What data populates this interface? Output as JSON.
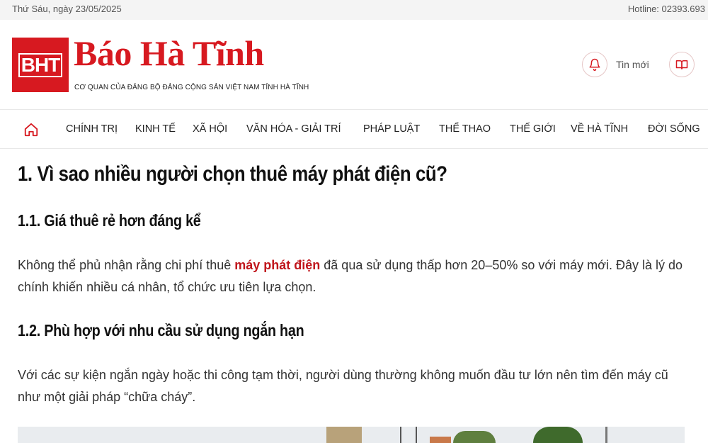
{
  "topbar": {
    "date": "Thứ Sáu, ngày 23/05/2025",
    "hotline": "Hotline: 02393.693"
  },
  "header": {
    "logo_mark": "BHT",
    "logo_title": "Báo Hà Tĩnh",
    "logo_subtitle": "CƠ QUAN CỦA ĐẢNG BỘ ĐẢNG CỘNG SẢN VIỆT NAM TỈNH HÀ TĨNH",
    "news_button_label": "Tin mới",
    "brand_color": "#d71920"
  },
  "nav": {
    "items": [
      "CHÍNH TRỊ",
      "KINH TẾ",
      "XÃ HỘI",
      "VĂN HÓA - GIẢI TRÍ",
      "PHÁP LUẬT",
      "THỂ THAO",
      "THẾ GIỚI",
      "VỀ HÀ TĨNH",
      "ĐỜI SỐNG"
    ]
  },
  "article": {
    "heading": "1. Vì sao nhiều người chọn thuê máy phát điện cũ?",
    "sections": [
      {
        "heading": "1.1. Giá thuê rẻ hơn đáng kể",
        "text_before_link": "Không thể phủ nhận rằng chi phí thuê ",
        "link": "máy phát điện",
        "text_after_link": " đã qua sử dụng thấp hơn 20–50% so với máy mới. Đây là lý do chính khiến nhiều cá nhân, tổ chức ưu tiên lựa chọn."
      },
      {
        "heading": "1.2. Phù hợp với nhu cầu sử dụng ngắn hạn",
        "text": "Với các sự kiện ngắn ngày hoặc thi công tạm thời, người dùng thường không muốn đầu tư lớn nên tìm đến máy cũ như một giải pháp “chữa cháy”."
      }
    ],
    "link_color": "#c0161c"
  }
}
